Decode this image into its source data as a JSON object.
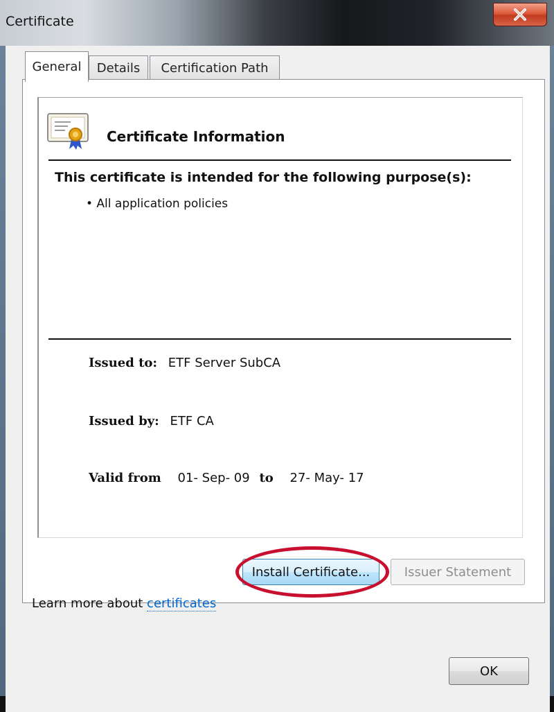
{
  "window": {
    "title": "Certificate"
  },
  "tabs": [
    {
      "label": "General",
      "active": true
    },
    {
      "label": "Details",
      "active": false
    },
    {
      "label": "Certification Path",
      "active": false
    }
  ],
  "info": {
    "heading": "Certificate Information",
    "purpose_heading": "This certificate is intended for the following purpose(s):",
    "purposes": [
      "• All application policies"
    ]
  },
  "fields": {
    "issued_to_label": "Issued to:",
    "issued_to_value": "ETF Server SubCA",
    "issued_by_label": "Issued by:",
    "issued_by_value": "ETF CA",
    "valid_from_label": "Valid from",
    "valid_from_value": "01- Sep- 09",
    "valid_to_label": "to",
    "valid_to_value": "27- May- 17"
  },
  "buttons": {
    "install": "Install Certificate...",
    "issuer_statement": "Issuer Statement",
    "ok": "OK"
  },
  "learn_more": {
    "prefix": "Learn more about ",
    "link": "certificates"
  },
  "colors": {
    "annotation": "#c8102e",
    "link": "#0066cc"
  }
}
